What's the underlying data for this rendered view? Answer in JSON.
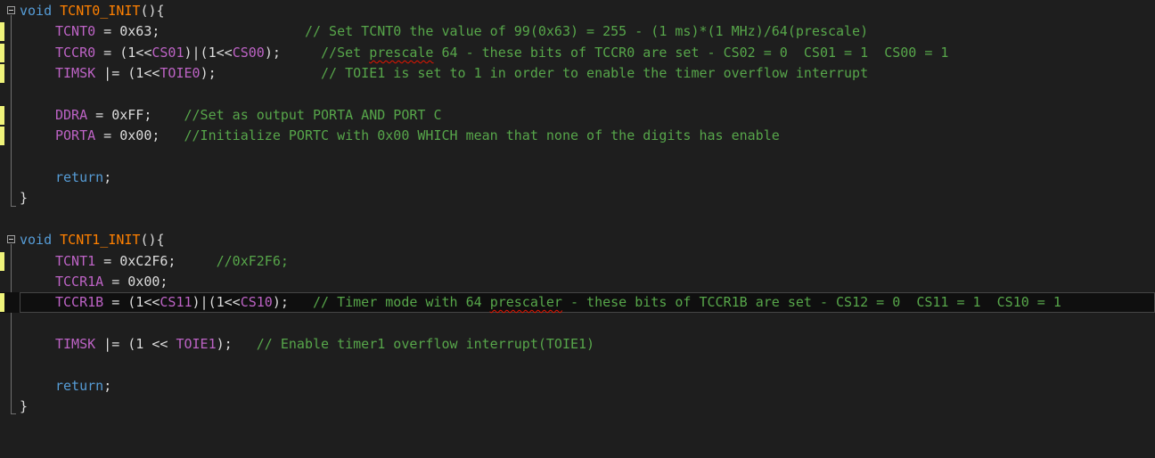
{
  "editor": {
    "func1": {
      "kw_void": "void",
      "name": "TCNT0_INIT",
      "open": "(){",
      "line1": {
        "reg": "TCNT0",
        "assign": " = 0x63;",
        "pad": "                  ",
        "comment": "// Set TCNT0 the value of 99(0x63) = 255 - (1 ms)*(1 MHz)/64(prescale)"
      },
      "line2": {
        "reg": "TCCR0",
        "p1": " = (1<<",
        "m1": "CS01",
        "p2": ")|(1<<",
        "m2": "CS00",
        "p3": ");",
        "pad": "     ",
        "c_pre": "//Set ",
        "c_squig": "prescale",
        "c_post": " 64 - these bits of TCCR0 are set - CS02 = 0  CS01 = 1  CS00 = 1"
      },
      "line3": {
        "reg": "TIMSK",
        "p1": " |= (1<<",
        "m1": "TOIE0",
        "p2": ");",
        "pad": "             ",
        "comment": "// TOIE1 is set to 1 in order to enable the timer overflow interrupt"
      },
      "line4": {
        "reg": "DDRA",
        "assign": " = 0xFF;",
        "pad": "    ",
        "comment": "//Set as output PORTA AND PORT C"
      },
      "line5": {
        "reg": "PORTA",
        "assign": " = 0x00;",
        "pad": "   ",
        "comment": "//Initialize PORTC with 0x00 WHICH mean that none of the digits has enable"
      },
      "ret": "return",
      "semi": ";",
      "close": "}"
    },
    "func2": {
      "kw_void": "void",
      "name": "TCNT1_INIT",
      "open": "(){",
      "line1": {
        "reg": "TCNT1",
        "assign": " = 0xC2F6;",
        "pad": "     ",
        "comment": "//0xF2F6;"
      },
      "line2": {
        "reg": "TCCR1A",
        "assign": " = 0x00;"
      },
      "line3": {
        "reg": "TCCR1B",
        "p1": " = (1<<",
        "m1": "CS11",
        "p2": ")|(1<<",
        "m2": "CS10",
        "p3": ");",
        "pad": "   ",
        "c_pre": "// Timer mode with 64 ",
        "c_squig": "prescaler",
        "c_post": " - these bits of TCCR1B are set - CS12 = 0  CS11 = 1  CS10 = 1"
      },
      "line4": {
        "reg": "TIMSK",
        "p1": " |= (1 << ",
        "m1": "TOIE1",
        "p2": ");",
        "pad": "   ",
        "comment": "// Enable timer1 overflow interrupt(TOIE1)"
      },
      "ret": "return",
      "semi": ";",
      "close": "}"
    }
  },
  "colors": {
    "background": "#1e1e1e",
    "keyword": "#569cd6",
    "function": "#ff8000",
    "macro": "#bd63c5",
    "comment": "#57a64a",
    "change_marker": "#eff37a"
  }
}
